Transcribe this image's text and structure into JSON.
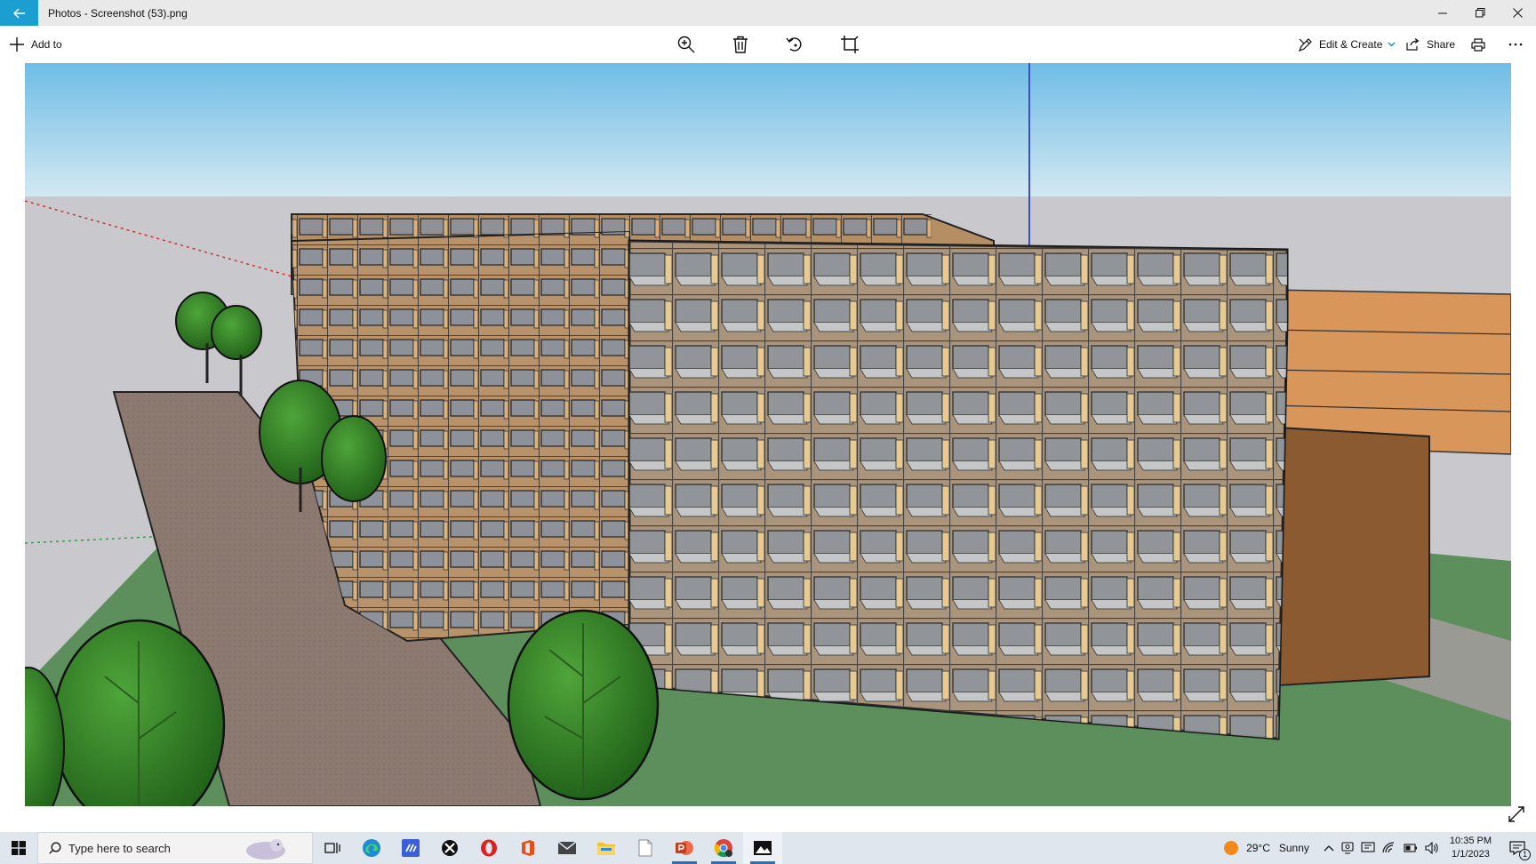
{
  "window": {
    "title": "Photos - Screenshot (53).png"
  },
  "toolbar": {
    "add_to_label": "Add to",
    "edit_create_label": "Edit & Create",
    "share_label": "Share"
  },
  "taskbar": {
    "search_placeholder": "Type here to search",
    "apps": [
      "task-view",
      "edge",
      "visual-studio-code",
      "xbox",
      "opera",
      "office",
      "mail",
      "file-explorer",
      "notepad",
      "powerpoint",
      "chrome",
      "photos"
    ],
    "weather": {
      "temperature": "29°C",
      "condition": "Sunny"
    },
    "clock": {
      "time": "10:35 PM",
      "date": "1/1/2023"
    },
    "notification_count": "1"
  },
  "colors": {
    "accent": "#1a9fd0",
    "titlebar_bg": "#e9e9e9",
    "taskbar_bg": "#dfe6ee"
  }
}
